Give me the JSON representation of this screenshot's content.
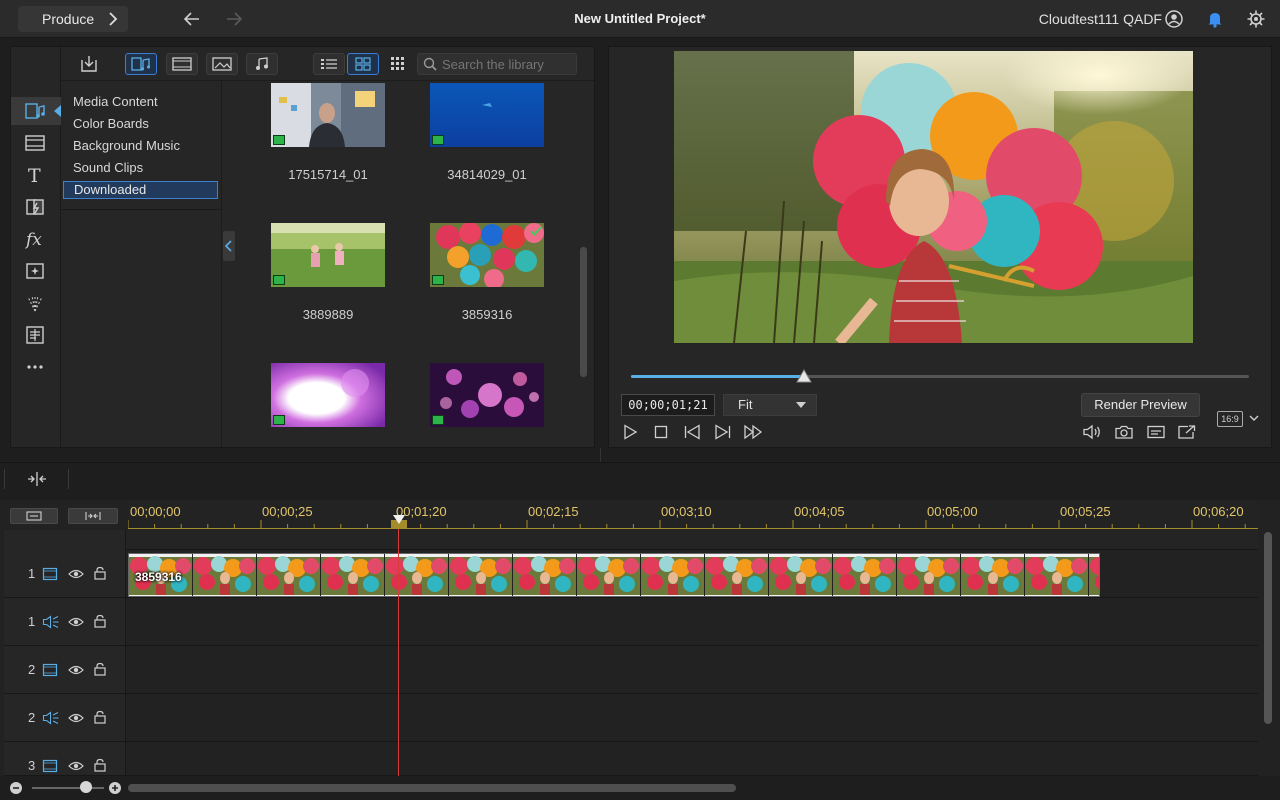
{
  "topbar": {
    "produce_label": "Produce",
    "project_title": "New Untitled Project*",
    "user_name": "Cloudtest111 QADF"
  },
  "library": {
    "search_placeholder": "Search the library",
    "folders": [
      {
        "label": "Media Content",
        "selected": false
      },
      {
        "label": "Color Boards",
        "selected": false
      },
      {
        "label": "Background Music",
        "selected": false
      },
      {
        "label": "Sound Clips",
        "selected": false
      },
      {
        "label": "Downloaded",
        "selected": true
      }
    ],
    "items": [
      {
        "label": "17515714_01",
        "kind": "video"
      },
      {
        "label": "34814029_01",
        "kind": "video"
      },
      {
        "label": "3889889",
        "kind": "video"
      },
      {
        "label": "3859316",
        "kind": "video",
        "in_use": true
      },
      {
        "label": "",
        "kind": "video"
      },
      {
        "label": "",
        "kind": "video"
      }
    ]
  },
  "preview": {
    "timecode": "00;00;01;21",
    "zoom_select": "Fit",
    "render_label": "Render Preview",
    "aspect_ratio": "16:9",
    "progress": 0.28
  },
  "timeline": {
    "ruler": [
      "00;00;00",
      "00;00;25",
      "00;01;20",
      "00;02;15",
      "00;03;10",
      "00;04;05",
      "00;05;00",
      "00;05;25",
      "00;06;20"
    ],
    "tracks": [
      {
        "num": "1",
        "type": "video"
      },
      {
        "num": "1",
        "type": "audio"
      },
      {
        "num": "2",
        "type": "video"
      },
      {
        "num": "2",
        "type": "audio"
      },
      {
        "num": "3",
        "type": "video"
      }
    ],
    "clip_label": "3859316"
  },
  "colors": {
    "accent": "#3a7bd5",
    "ruler_text": "#e3c66a",
    "playhead": "#d63a3a",
    "seek_fill": "#5aaee6"
  }
}
